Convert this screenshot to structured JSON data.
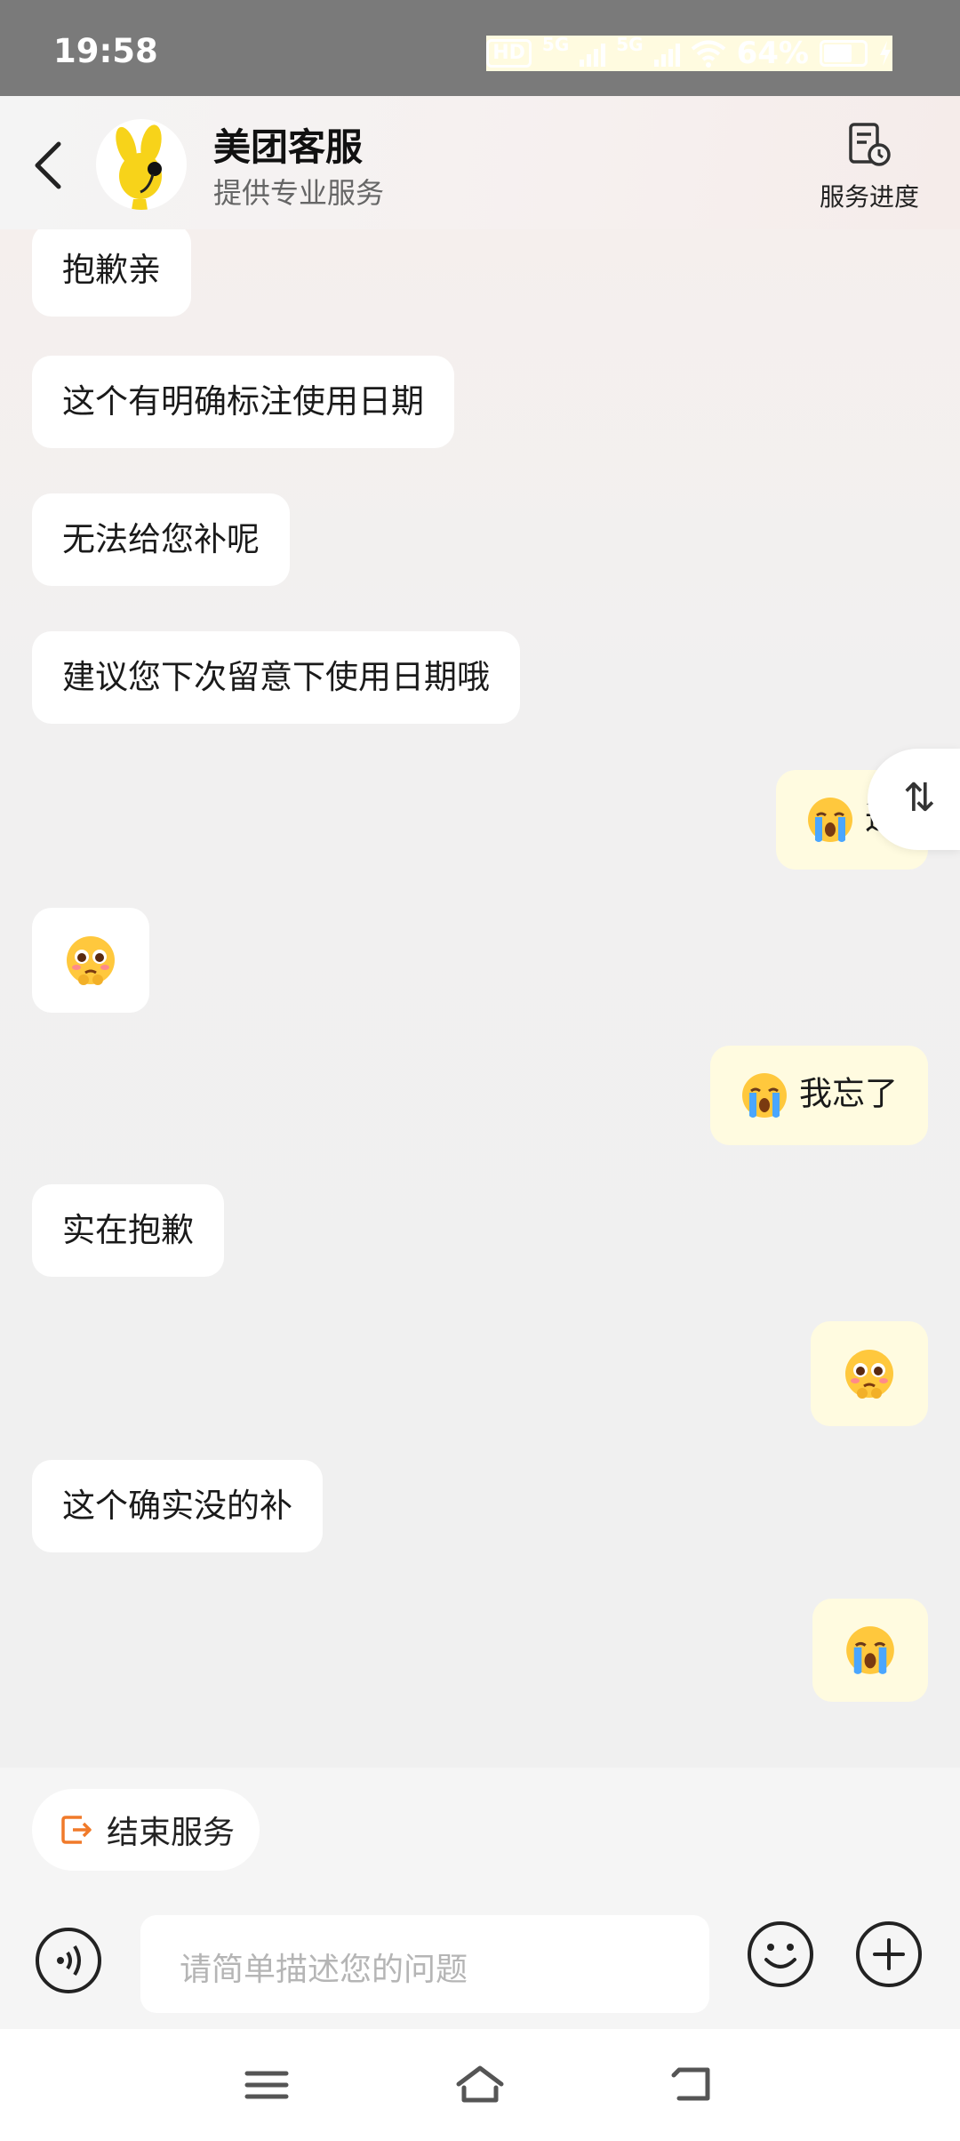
{
  "status_bar": {
    "time": "19:58",
    "hd_label": "HD",
    "network_1": "5G",
    "network_2": "5G",
    "battery": "64%"
  },
  "header": {
    "title": "美团客服",
    "subtitle": "提供专业服务",
    "progress_label": "服务进度"
  },
  "messages": [
    {
      "side": "left",
      "text": "抱歉亲"
    },
    {
      "side": "left",
      "text": "这个有明确标注使用日期"
    },
    {
      "side": "left",
      "text": "无法给您补呢"
    },
    {
      "side": "left",
      "text": "建议您下次留意下使用日期哦"
    },
    {
      "side": "right",
      "emoji": "crying-face",
      "text": "这"
    },
    {
      "side": "left",
      "emoji": "pleading-face",
      "text": ""
    },
    {
      "side": "right",
      "emoji": "crying-face",
      "text": "我忘了"
    },
    {
      "side": "left",
      "text": "实在抱歉"
    },
    {
      "side": "right",
      "emoji": "pleading-face",
      "text": ""
    },
    {
      "side": "left",
      "text": "这个确实没的补"
    },
    {
      "side": "right",
      "emoji": "crying-face",
      "text": ""
    }
  ],
  "swap_icon": "⇅",
  "bottom": {
    "end_service_label": "结束服务",
    "input_placeholder": "请简单描述您的问题"
  },
  "colors": {
    "status_bar": "#7a7a7a",
    "user_bubble": "#fffbe0",
    "agent_bubble": "#ffffff",
    "end_icon": "#f07a2a"
  }
}
